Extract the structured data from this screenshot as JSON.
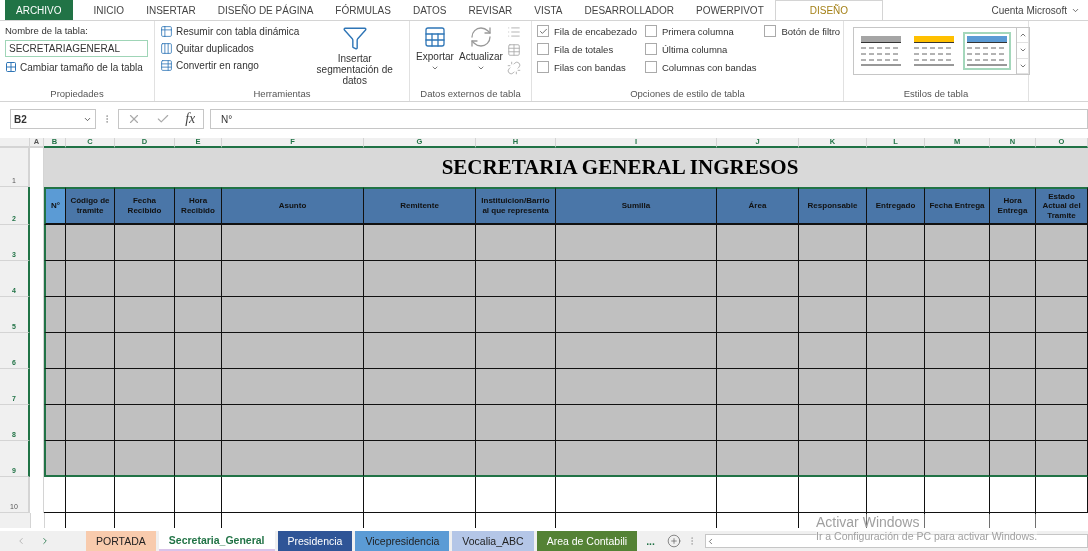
{
  "ribbon_tabs": [
    {
      "label": "ARCHIVO",
      "kind": "file",
      "selected": false
    },
    {
      "label": "INICIO",
      "kind": "tab",
      "selected": false
    },
    {
      "label": "INSERTAR",
      "kind": "tab",
      "selected": false
    },
    {
      "label": "DISEÑO DE PÁGINA",
      "kind": "tab",
      "selected": false
    },
    {
      "label": "FÓRMULAS",
      "kind": "tab",
      "selected": false
    },
    {
      "label": "DATOS",
      "kind": "tab",
      "selected": false
    },
    {
      "label": "REVISAR",
      "kind": "tab",
      "selected": false
    },
    {
      "label": "VISTA",
      "kind": "tab",
      "selected": false
    },
    {
      "label": "DESARROLLADOR",
      "kind": "tab",
      "selected": false
    },
    {
      "label": "POWERPIVOT",
      "kind": "tab",
      "selected": false
    },
    {
      "label": "DISEÑO",
      "kind": "contextual",
      "selected": true
    }
  ],
  "account": "Cuenta Microsoft",
  "ribbon": {
    "properties": {
      "name_label": "Nombre de la tabla:",
      "table_name": "SECRETARIAGENERAL",
      "resize": "Cambiar tamaño de la tabla",
      "title": "Propiedades"
    },
    "tools": {
      "items": [
        "Resumir con tabla dinámica",
        "Quitar duplicados",
        "Convertir en rango"
      ],
      "slicer": "Insertar segmentación de datos",
      "title": "Herramientas"
    },
    "external": {
      "buttons": [
        "Exportar",
        "Actualizar"
      ],
      "title": "Datos externos de tabla"
    },
    "style_options": {
      "columns": [
        [
          {
            "label": "Fila de encabezado",
            "checked": true
          },
          {
            "label": "Fila de totales",
            "checked": false
          },
          {
            "label": "Filas con bandas",
            "checked": false
          }
        ],
        [
          {
            "label": "Primera columna",
            "checked": false
          },
          {
            "label": "Última columna",
            "checked": false
          },
          {
            "label": "Columnas con bandas",
            "checked": false
          }
        ],
        [
          {
            "label": "Botón de filtro",
            "checked": false
          }
        ]
      ],
      "title": "Opciones de estilo de tabla"
    },
    "styles": {
      "items": [
        {
          "color": "#a5a5a5",
          "selected": false
        },
        {
          "color": "#ffc000",
          "selected": false
        },
        {
          "color": "#5b9bd5",
          "selected": true
        }
      ],
      "title": "Estilos de tabla"
    }
  },
  "formula_bar": {
    "name_box": "B2",
    "function_label": "fx",
    "value": "N°"
  },
  "sheet": {
    "columns": [
      {
        "letter": "A",
        "selected": false
      },
      {
        "letter": "B",
        "selected": true
      },
      {
        "letter": "C",
        "selected": true
      },
      {
        "letter": "D",
        "selected": true
      },
      {
        "letter": "E",
        "selected": true
      },
      {
        "letter": "F",
        "selected": true
      },
      {
        "letter": "G",
        "selected": true
      },
      {
        "letter": "H",
        "selected": true
      },
      {
        "letter": "I",
        "selected": true
      },
      {
        "letter": "J",
        "selected": true
      },
      {
        "letter": "K",
        "selected": true
      },
      {
        "letter": "L",
        "selected": true
      },
      {
        "letter": "M",
        "selected": true
      },
      {
        "letter": "N",
        "selected": true
      },
      {
        "letter": "O",
        "selected": true
      }
    ],
    "rows": [
      {
        "number": "1",
        "kind": "title",
        "selected": false
      },
      {
        "number": "2",
        "kind": "header",
        "selected": true
      },
      {
        "number": "3",
        "kind": "body",
        "selected": true
      },
      {
        "number": "4",
        "kind": "body",
        "selected": true
      },
      {
        "number": "5",
        "kind": "body",
        "selected": true
      },
      {
        "number": "6",
        "kind": "body",
        "selected": true
      },
      {
        "number": "7",
        "kind": "body",
        "selected": true
      },
      {
        "number": "8",
        "kind": "body",
        "selected": true
      },
      {
        "number": "9",
        "kind": "body",
        "selected": true
      },
      {
        "number": "10",
        "kind": "plain",
        "selected": false
      }
    ],
    "title": "SECRETARIA GENERAL INGRESOS",
    "headers": [
      {
        "label": "N°",
        "active": true
      },
      {
        "label": "Código de tramite",
        "active": false
      },
      {
        "label": "Fecha Recibido",
        "active": false
      },
      {
        "label": "Hora Recibido",
        "active": false
      },
      {
        "label": "Asunto",
        "active": false
      },
      {
        "label": "Remitente",
        "active": false
      },
      {
        "label": "Instituicion/Barrio al que representa",
        "active": false
      },
      {
        "label": "Sumilla",
        "active": false
      },
      {
        "label": "Área",
        "active": false
      },
      {
        "label": "Responsable",
        "active": false
      },
      {
        "label": "Entregado",
        "active": false
      },
      {
        "label": "Fecha Entrega",
        "active": false
      },
      {
        "label": "Hora Entrega",
        "active": false
      },
      {
        "label": "Estado Actual del Tramite",
        "active": false
      }
    ]
  },
  "sheet_tabs": [
    {
      "label": "PORTADA",
      "color": "#f8cbad",
      "selected": false
    },
    {
      "label": "Secretaria_General",
      "color": "#d9c3e9",
      "selected": true
    },
    {
      "label": "Presidencia",
      "color": "#2f5597",
      "selected": false
    },
    {
      "label": "Vicepresidencia",
      "color": "#5b9bd5",
      "selected": false
    },
    {
      "label": "Vocalia_ABC",
      "color": "#b4c6e7",
      "selected": false
    },
    {
      "label": "Area de Contabili",
      "color": "#548235",
      "selected": false
    }
  ],
  "more_tabs": "...",
  "activation_notice": {
    "title": "Activar Windows",
    "message": "Ir a Configuración de PC para activar Windows."
  }
}
